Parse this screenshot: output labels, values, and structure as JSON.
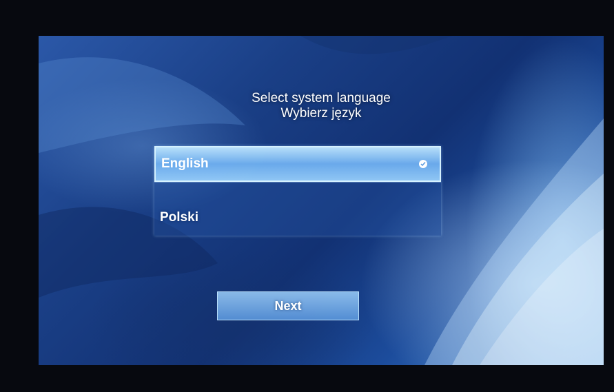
{
  "header": {
    "title_line1": "Select system language",
    "title_line2": "Wybierz język"
  },
  "languages": [
    {
      "label": "English",
      "selected": true
    },
    {
      "label": "Polski",
      "selected": false
    }
  ],
  "footer": {
    "next_label": "Next"
  },
  "colors": {
    "accent": "#9fd0f5",
    "background": "#1a3f86",
    "text": "#ffffff"
  },
  "icons": {
    "selected_indicator": "check-icon"
  }
}
